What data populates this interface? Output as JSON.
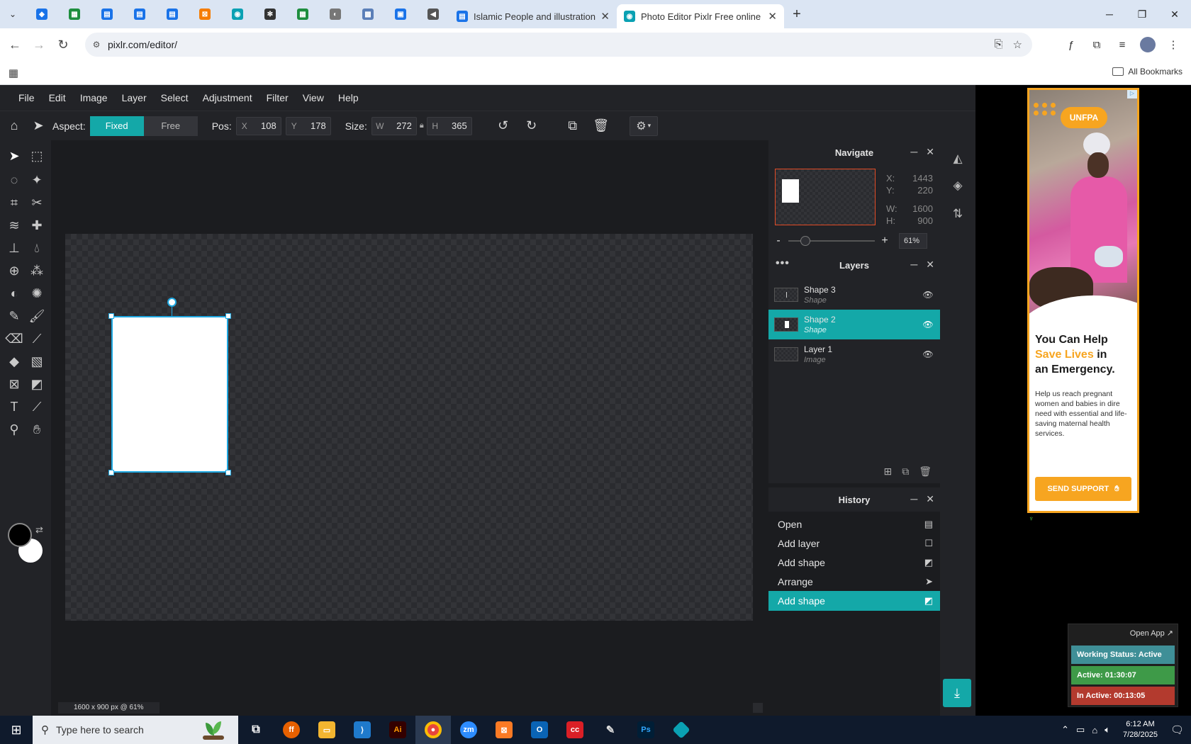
{
  "browser": {
    "pinned_tabs": [
      {
        "icon": "vpn-icon",
        "color": "#1a73e8"
      },
      {
        "icon": "sheets-icon",
        "color": "#1e8e3e"
      },
      {
        "icon": "docs-icon",
        "color": "#1a73e8"
      },
      {
        "icon": "docs-icon",
        "color": "#1a73e8"
      },
      {
        "icon": "docs-icon",
        "color": "#1a73e8"
      },
      {
        "icon": "xampp-icon",
        "color": "#f57c00"
      },
      {
        "icon": "app-icon",
        "color": "#0aa1b3"
      },
      {
        "icon": "chatgpt-icon",
        "color": "#333333"
      },
      {
        "icon": "sheets-icon",
        "color": "#1e8e3e"
      },
      {
        "icon": "globe-icon",
        "color": "#777777"
      },
      {
        "icon": "qr-icon",
        "color": "#5b7fb8"
      },
      {
        "icon": "forms-icon",
        "color": "#1a73e8"
      },
      {
        "icon": "audio-icon",
        "color": "#555555"
      }
    ],
    "tabs": [
      {
        "title": "Islamic People and illustration v",
        "active": false
      },
      {
        "title": "Photo Editor Pixlr Free online In",
        "active": true
      }
    ],
    "url": "pixlr.com/editor/",
    "all_bookmarks": "All Bookmarks"
  },
  "pixlr": {
    "menu": [
      "File",
      "Edit",
      "Image",
      "Layer",
      "Select",
      "Adjustment",
      "Filter",
      "View",
      "Help"
    ],
    "toolbar": {
      "aspect_label": "Aspect:",
      "aspect_fixed": "Fixed",
      "aspect_free": "Free",
      "pos_label": "Pos:",
      "x_label": "X",
      "x_value": "108",
      "y_label": "Y",
      "y_value": "178",
      "size_label": "Size:",
      "w_label": "W",
      "w_value": "272",
      "h_label": "H",
      "h_value": "365"
    },
    "status": "1600 x 900 px @ 61%",
    "navigate": {
      "title": "Navigate",
      "x_label": "X:",
      "x": "1443",
      "y_label": "Y:",
      "y": "220",
      "w_label": "W:",
      "w": "1600",
      "h_label": "H:",
      "h": "900",
      "zoom": "61%",
      "zoom_fraction": 0.2
    },
    "layers": {
      "title": "Layers",
      "items": [
        {
          "name": "Shape 3",
          "type": "Shape",
          "active": false
        },
        {
          "name": "Shape 2",
          "type": "Shape",
          "active": true
        },
        {
          "name": "Layer 1",
          "type": "Image",
          "active": false
        }
      ]
    },
    "history": {
      "title": "History",
      "items": [
        {
          "label": "Open",
          "icon": "document-icon",
          "active": false
        },
        {
          "label": "Add layer",
          "icon": "square-icon",
          "active": false
        },
        {
          "label": "Add shape",
          "icon": "shapes-icon",
          "active": false
        },
        {
          "label": "Arrange",
          "icon": "pointer-icon",
          "active": false
        },
        {
          "label": "Add shape",
          "icon": "shapes-icon",
          "active": true
        }
      ]
    },
    "accent": "#14a8a8"
  },
  "ad": {
    "logo": "UNFPA",
    "headline_1": "You Can Help",
    "headline_highlight": "Save Lives",
    "headline_2": "in",
    "headline_3": "an Emergency.",
    "copy": "Help us reach pregnant women and babies in dire need with essential and life-saving maternal health services.",
    "cta": "SEND SUPPORT",
    "accent": "#f7a520"
  },
  "work_status": {
    "open_app": "Open App ↗",
    "status": "Working Status: Active",
    "active": "Active: 01:30:07",
    "inactive": "In Active: 00:13:05"
  },
  "taskbar": {
    "search_placeholder": "Type here to search",
    "time": "6:12 AM",
    "date": "7/28/2025"
  }
}
